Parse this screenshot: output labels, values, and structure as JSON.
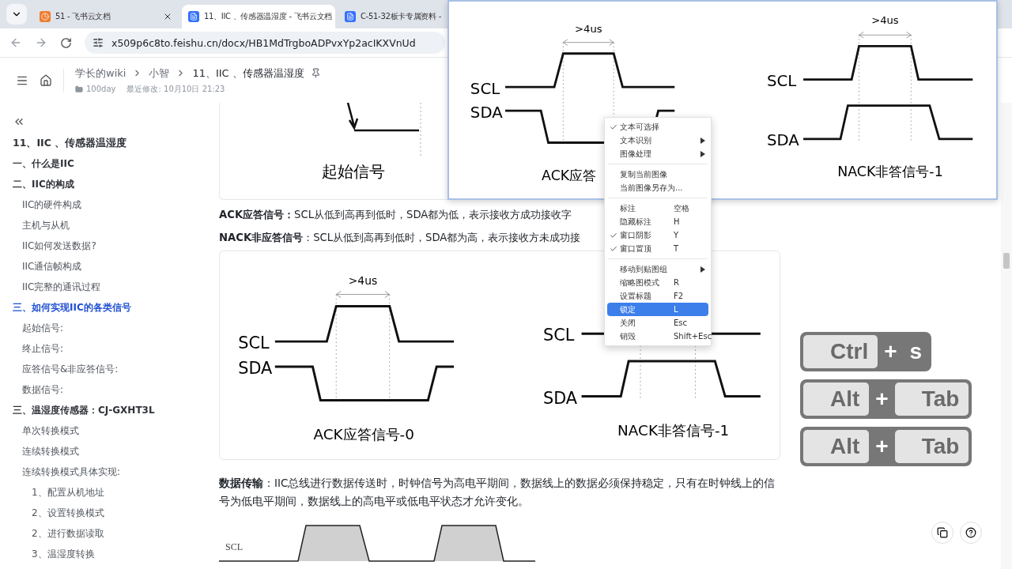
{
  "browser": {
    "tabs": [
      {
        "kind": "clock",
        "title": "51 - 飞书云文档",
        "selected": false
      },
      {
        "kind": "doc",
        "title": "11、IIC 、传感器温湿度 - 飞书云文档",
        "selected": true
      },
      {
        "kind": "doc",
        "title": "C-51-32板卡专属资料 -",
        "selected": false
      }
    ],
    "url": "x509p6c8to.feishu.cn/docx/HB1MdTrgboADPvxYp2acIKXVnUd"
  },
  "doc_header": {
    "breadcrumb": [
      "学长的wiki",
      "小智",
      "11、IIC 、传感器温湿度"
    ],
    "folder": "100day",
    "modified": "最近修改: 10月10日 21:23"
  },
  "outline": {
    "title": "11、IIC 、传感器温湿度",
    "items": [
      {
        "label": "一、什么是IIC",
        "selected": false
      },
      {
        "label": "二、IIC的构成",
        "selected": false,
        "children": [
          {
            "label": "IIC的硬件构成",
            "selected": false
          },
          {
            "label": "主机与从机",
            "selected": false
          },
          {
            "label": "IIC如何发送数据?",
            "selected": false
          },
          {
            "label": "IIC通信帧构成",
            "selected": false
          },
          {
            "label": "IIC完整的通讯过程",
            "selected": false
          }
        ]
      },
      {
        "label": "三、如何实现IIC的各类信号",
        "selected": true,
        "children": [
          {
            "label": "起始信号:",
            "selected": false
          },
          {
            "label": "终止信号:",
            "selected": false
          },
          {
            "label": "应答信号&非应答信号:",
            "selected": false
          },
          {
            "label": "数据信号:",
            "selected": false
          }
        ]
      },
      {
        "label": "三、温湿度传感器：CJ-GXHT3L",
        "selected": false,
        "children": [
          {
            "label": "单次转换模式",
            "selected": false
          },
          {
            "label": "连续转换模式",
            "selected": false
          },
          {
            "label": "连续转换模式具体实现:",
            "selected": false,
            "children": [
              {
                "label": "1、配置从机地址",
                "selected": false
              },
              {
                "label": "2、设置转换模式",
                "selected": false
              },
              {
                "label": "2、进行数据读取",
                "selected": false
              },
              {
                "label": "3、温湿度转换",
                "selected": false
              }
            ]
          }
        ]
      }
    ]
  },
  "content": {
    "start_figure": {
      "caption": "起始信号"
    },
    "notes": [
      "**ACK应答信号：**SCL从低到高再到低时，SDA都为低，表示接收方成功接收字",
      "**NACK非应答信号**：SCL从低到高再到低时，SDA都为高，表示接收方未成功接"
    ],
    "signal_figure": {
      "panels": [
        {
          "kind": "ack",
          "scl": "SCL",
          "sda": "SDA",
          "duration": ">4us",
          "caption": "ACK应答信号-0"
        },
        {
          "kind": "nack",
          "scl": "SCL",
          "sda": "SDA",
          "caption": "NACK非答信号-1"
        }
      ]
    },
    "transfer_text": "**数据传输**：IIC总线进行数据传送时，时钟信号为高电平期间，数据线上的数据必须保持稳定，只有在时钟线上的信号为低电平期间，数据线上的高电平或低电平状态才允许变化。",
    "data_figure": {
      "scl": "SCL"
    }
  },
  "pinned_image": {
    "panels": [
      {
        "kind": "ack",
        "scl": "SCL",
        "sda": "SDA",
        "duration": ">4us",
        "caption": "ACK应答"
      },
      {
        "kind": "nack",
        "scl": "SCL",
        "sda": "SDA",
        "duration": ">4us",
        "caption": "NACK非答信号-1"
      }
    ]
  },
  "context_menu": {
    "groups": [
      {
        "items": [
          {
            "label": "文本可选择",
            "checked": true,
            "submenu": false,
            "selected": false
          },
          {
            "label": "文本识别",
            "checked": false,
            "submenu": true,
            "selected": false
          },
          {
            "label": "图像处理",
            "checked": false,
            "submenu": true,
            "selected": false
          }
        ]
      },
      {
        "items": [
          {
            "label": "复制当前图像",
            "checked": false,
            "submenu": false,
            "selected": false
          },
          {
            "label": "当前图像另存为...",
            "checked": false,
            "submenu": false,
            "selected": false
          }
        ]
      },
      {
        "items": [
          {
            "label": "标注",
            "shortcut": "空格",
            "checked": false,
            "submenu": false,
            "selected": false
          },
          {
            "label": "隐藏标注",
            "shortcut": "H",
            "checked": false,
            "submenu": false,
            "selected": false
          },
          {
            "label": "窗口阴影",
            "shortcut": "Y",
            "checked": true,
            "submenu": false,
            "selected": false
          },
          {
            "label": "窗口置顶",
            "shortcut": "T",
            "checked": true,
            "submenu": false,
            "selected": false
          }
        ]
      },
      {
        "items": [
          {
            "label": "移动到贴图组",
            "checked": false,
            "submenu": true,
            "selected": false
          },
          {
            "label": "缩略图模式",
            "shortcut": "R",
            "checked": false,
            "submenu": false,
            "selected": false
          },
          {
            "label": "设置标题",
            "shortcut": "F2",
            "checked": false,
            "submenu": false,
            "selected": false
          },
          {
            "label": "锁定",
            "shortcut": "L",
            "checked": false,
            "submenu": false,
            "selected": true
          },
          {
            "label": "关闭",
            "shortcut": "Esc",
            "checked": false,
            "submenu": false,
            "selected": false
          },
          {
            "label": "销毁",
            "shortcut": "Shift+Esc",
            "checked": false,
            "submenu": false,
            "selected": false
          }
        ]
      }
    ]
  },
  "key_overlays": [
    {
      "keys": [
        {
          "kind": "cap",
          "label": "Ctrl"
        },
        {
          "kind": "sign",
          "label": "+"
        },
        {
          "kind": "sign",
          "label": "s"
        }
      ]
    },
    {
      "keys": [
        {
          "kind": "cap",
          "label": "Alt"
        },
        {
          "kind": "sign",
          "label": "+"
        },
        {
          "kind": "cap",
          "label": "Tab"
        }
      ]
    },
    {
      "keys": [
        {
          "kind": "cap",
          "label": "Alt"
        },
        {
          "kind": "sign",
          "label": "+"
        },
        {
          "kind": "cap",
          "label": "Tab"
        }
      ]
    }
  ]
}
